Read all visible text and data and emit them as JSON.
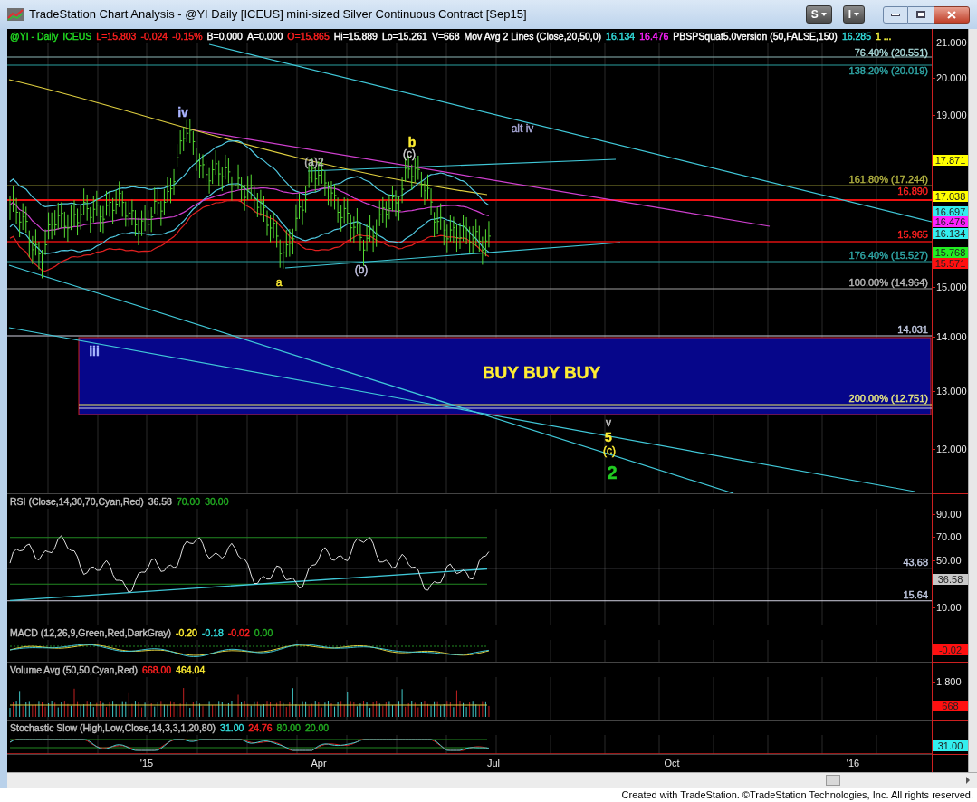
{
  "window": {
    "title": "TradeStation Chart Analysis - @YI Daily [ICEUS] mini-sized Silver Continuous Contract [Sep15]",
    "toolbar_buttons": [
      "S",
      "I"
    ]
  },
  "price_pane": {
    "legend": [
      {
        "text": "@YI - Daily",
        "color": "#22dd22"
      },
      {
        "text": "ICEUS",
        "color": "#22dd22"
      },
      {
        "text": "L=15.803",
        "color": "#ff2020"
      },
      {
        "text": "-0.024",
        "color": "#ff2020"
      },
      {
        "text": "-0.15%",
        "color": "#ff2020"
      },
      {
        "text": "B=0.000",
        "color": "#ffffff"
      },
      {
        "text": "A=0.000",
        "color": "#ffffff"
      },
      {
        "text": "O=15.865",
        "color": "#ff2020"
      },
      {
        "text": "Hi=15.889",
        "color": "#ffffff"
      },
      {
        "text": "Lo=15.261",
        "color": "#ffffff"
      },
      {
        "text": "V=668",
        "color": "#ffffff"
      },
      {
        "text": "Mov Avg 2 Lines (Close,20,50,0)",
        "color": "#ffffff"
      },
      {
        "text": "16.134",
        "color": "#33e0e0"
      },
      {
        "text": "16.476",
        "color": "#ff22ff"
      },
      {
        "text": "PBSPSquat5.0version (50,FALSE,150)",
        "color": "#ffffff"
      },
      {
        "text": "16.285",
        "color": "#33e0e0"
      },
      {
        "text": "1 ...",
        "color": "#ffff40"
      }
    ],
    "annotations": [
      {
        "text": "iv",
        "kind": "major",
        "color": "#aab4ff"
      },
      {
        "text": "alt iv",
        "kind": "minor",
        "color": "#a8a8d8"
      },
      {
        "text": "b",
        "kind": "major",
        "color": "#ffee33"
      },
      {
        "text": "(c)",
        "kind": "minor",
        "color": "#d0d0d0"
      },
      {
        "text": "(a)2",
        "kind": "minor",
        "color": "#b8b8b8"
      },
      {
        "text": "(b)",
        "kind": "minor",
        "color": "#c8c8e8"
      },
      {
        "text": "a",
        "kind": "minor",
        "color": "#ffee33"
      },
      {
        "text": "iii",
        "kind": "major",
        "color": "#a8b8ff"
      },
      {
        "text": "BUY BUY BUY",
        "kind": "banner",
        "color": "#ffee33"
      },
      {
        "text": "v",
        "kind": "minor",
        "color": "#c8c8c8"
      },
      {
        "text": "5",
        "kind": "major",
        "color": "#ffee33"
      },
      {
        "text": "(c)",
        "kind": "minor",
        "color": "#ffee33"
      },
      {
        "text": "2",
        "kind": "huge",
        "color": "#22cc22"
      }
    ],
    "level_labels": [
      {
        "text": "76.40% (20.551)",
        "color": "#a8d8d8"
      },
      {
        "text": "138.20% (20.019)",
        "color": "#30a8a8"
      },
      {
        "text": "161.80% (17.244)",
        "color": "#b0b040"
      },
      {
        "text": "16.890",
        "color": "#ff2020"
      },
      {
        "text": "15.965",
        "color": "#ff2020"
      },
      {
        "text": "176.40% (15.527)",
        "color": "#30a8a8"
      },
      {
        "text": "100.00% (14.964)",
        "color": "#b8b8b8"
      },
      {
        "text": "14.031",
        "color": "#c0c8e0"
      },
      {
        "text": "200.00% (12.751)",
        "color": "#e8e880"
      }
    ],
    "axis_ticks": [
      "21.000",
      "20.000",
      "19.000",
      "15.000",
      "14.000",
      "13.000",
      "12.000"
    ],
    "axis_markers": [
      {
        "text": "17.871",
        "color": "#ffff00"
      },
      {
        "text": "17.038",
        "color": "#ffff00"
      },
      {
        "text": "16.697",
        "color": "#33eeee"
      },
      {
        "text": "16.476",
        "color": "#ff22ff"
      },
      {
        "text": "16.134",
        "color": "#33eeee"
      },
      {
        "text": "15.768",
        "color": "#22ee22"
      },
      {
        "text": "15.571",
        "color": "#ff1010"
      }
    ]
  },
  "rsi_pane": {
    "legend": [
      {
        "text": "RSI (Close,14,30,70,Cyan,Red)",
        "color": "#c0c0c0"
      },
      {
        "text": "36.58",
        "color": "#c0c0c0"
      },
      {
        "text": "70.00",
        "color": "#22aa22"
      },
      {
        "text": "30.00",
        "color": "#22aa22"
      }
    ],
    "level_labels": [
      {
        "text": "43.68",
        "color": "#c0c8e0"
      },
      {
        "text": "15.64",
        "color": "#c0c8e0"
      }
    ],
    "axis_ticks": [
      "90.00",
      "70.00",
      "50.00",
      "10.00"
    ],
    "axis_markers": [
      {
        "text": "36.58",
        "color": "#c8c8c8"
      }
    ]
  },
  "macd_pane": {
    "legend": [
      {
        "text": "MACD (12,26,9,Green,Red,DarkGray)",
        "color": "#c0c0c0"
      },
      {
        "text": "-0.20",
        "color": "#ffee33"
      },
      {
        "text": "-0.18",
        "color": "#33dddd"
      },
      {
        "text": "-0.02",
        "color": "#ff2020"
      },
      {
        "text": "0.00",
        "color": "#22aa22"
      }
    ],
    "axis_markers": [
      {
        "text": "-0.02",
        "color": "#ff1010"
      }
    ]
  },
  "volume_pane": {
    "legend": [
      {
        "text": "Volume Avg (50,50,Cyan,Red)",
        "color": "#c0c0c0"
      },
      {
        "text": "668.00",
        "color": "#ff2020"
      },
      {
        "text": "464.04",
        "color": "#ffee33"
      }
    ],
    "axis_ticks": [
      "1,800"
    ],
    "axis_markers": [
      {
        "text": "668",
        "color": "#ff1010"
      }
    ]
  },
  "stochastic_pane": {
    "legend": [
      {
        "text": "Stochastic Slow (High,Low,Close,14,3,3,1,20,80)",
        "color": "#c0c0c0"
      },
      {
        "text": "31.00",
        "color": "#33dddd"
      },
      {
        "text": "24.76",
        "color": "#ff2020"
      },
      {
        "text": "80.00",
        "color": "#22aa22"
      },
      {
        "text": "20.00",
        "color": "#22aa22"
      }
    ],
    "axis_markers": [
      {
        "text": "31.00",
        "color": "#33eeee"
      }
    ]
  },
  "time_axis": [
    "'15",
    "Apr",
    "Jul",
    "Oct",
    "'16"
  ],
  "footer": "Created with TradeStation. ©TradeStation Technologies, Inc. All rights reserved."
}
